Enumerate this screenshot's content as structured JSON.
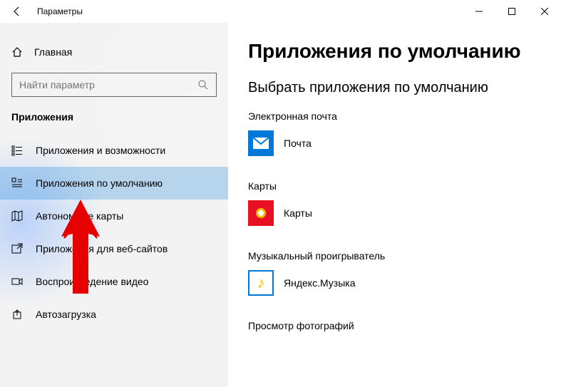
{
  "titlebar": {
    "title": "Параметры"
  },
  "sidebar": {
    "home": "Главная",
    "search_placeholder": "Найти параметр",
    "section": "Приложения",
    "items": [
      {
        "label": "Приложения и возможности"
      },
      {
        "label": "Приложения по умолчанию"
      },
      {
        "label": "Автономные карты"
      },
      {
        "label": "Приложения для веб-сайтов"
      },
      {
        "label": "Воспроизведение видео"
      },
      {
        "label": "Автозагрузка"
      }
    ]
  },
  "content": {
    "heading": "Приложения по умолчанию",
    "subheading": "Выбрать приложения по умолчанию",
    "categories": [
      {
        "label": "Электронная почта",
        "app": "Почта"
      },
      {
        "label": "Карты",
        "app": "Карты"
      },
      {
        "label": "Музыкальный проигрыватель",
        "app": "Яндекс.Музыка"
      },
      {
        "label": "Просмотр фотографий",
        "app": ""
      }
    ]
  }
}
